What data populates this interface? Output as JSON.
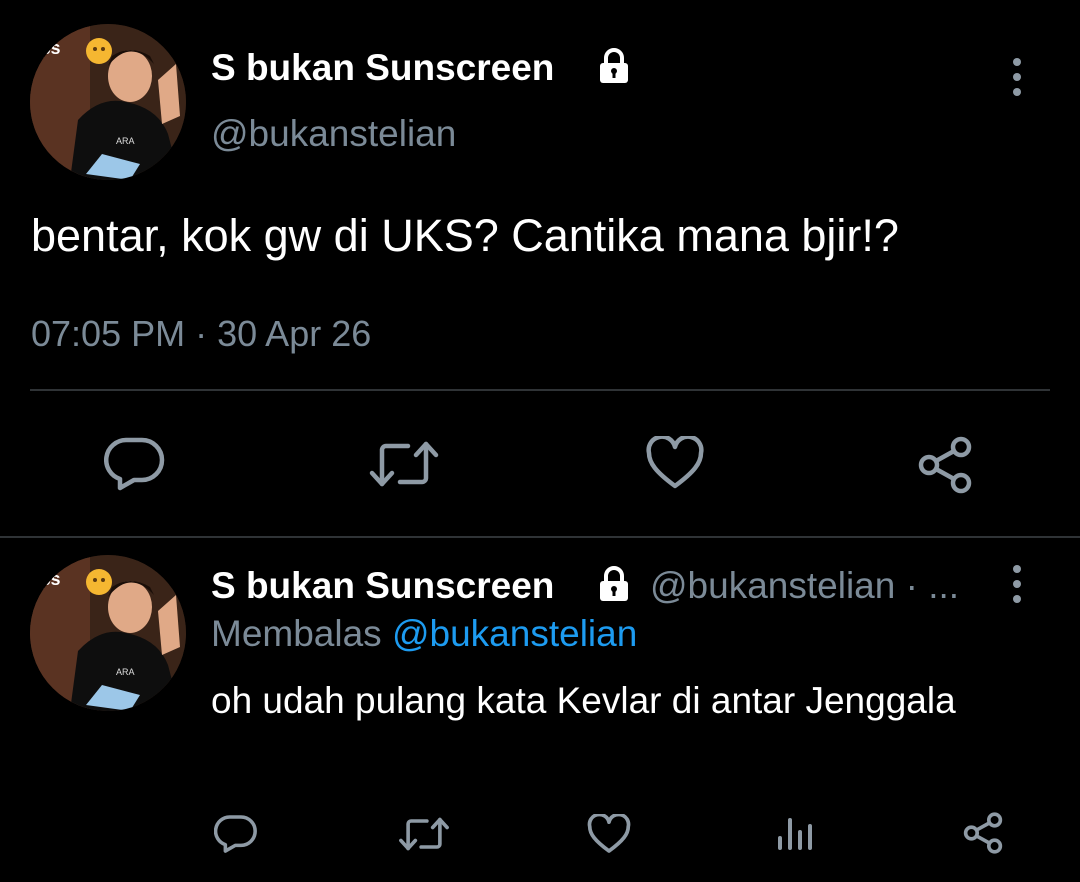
{
  "main_tweet": {
    "avatar_badge": "ps",
    "display_name": "S bukan Sunscreen",
    "handle": "@bukanstelian",
    "text": "bentar, kok gw di UKS? Cantika mana bjir!?",
    "time": "07:05 PM",
    "separator": "·",
    "date": "30 Apr 26",
    "actions": [
      "reply-icon",
      "retweet-icon",
      "like-icon",
      "share-icon"
    ]
  },
  "reply_tweet": {
    "avatar_badge": "ps",
    "display_name": "S bukan Sunscreen",
    "handle": "@bukanstelian · ...",
    "replying_label": "Membalas",
    "replying_to": "@bukanstelian",
    "text": "oh udah pulang kata Kevlar di antar Jenggala",
    "actions": [
      "reply-icon",
      "retweet-icon",
      "like-icon",
      "analytics-icon",
      "share-icon"
    ]
  },
  "colors": {
    "background": "#000000",
    "muted": "#7b8a97",
    "link": "#1d9bf0",
    "divider": "#2f3336"
  }
}
